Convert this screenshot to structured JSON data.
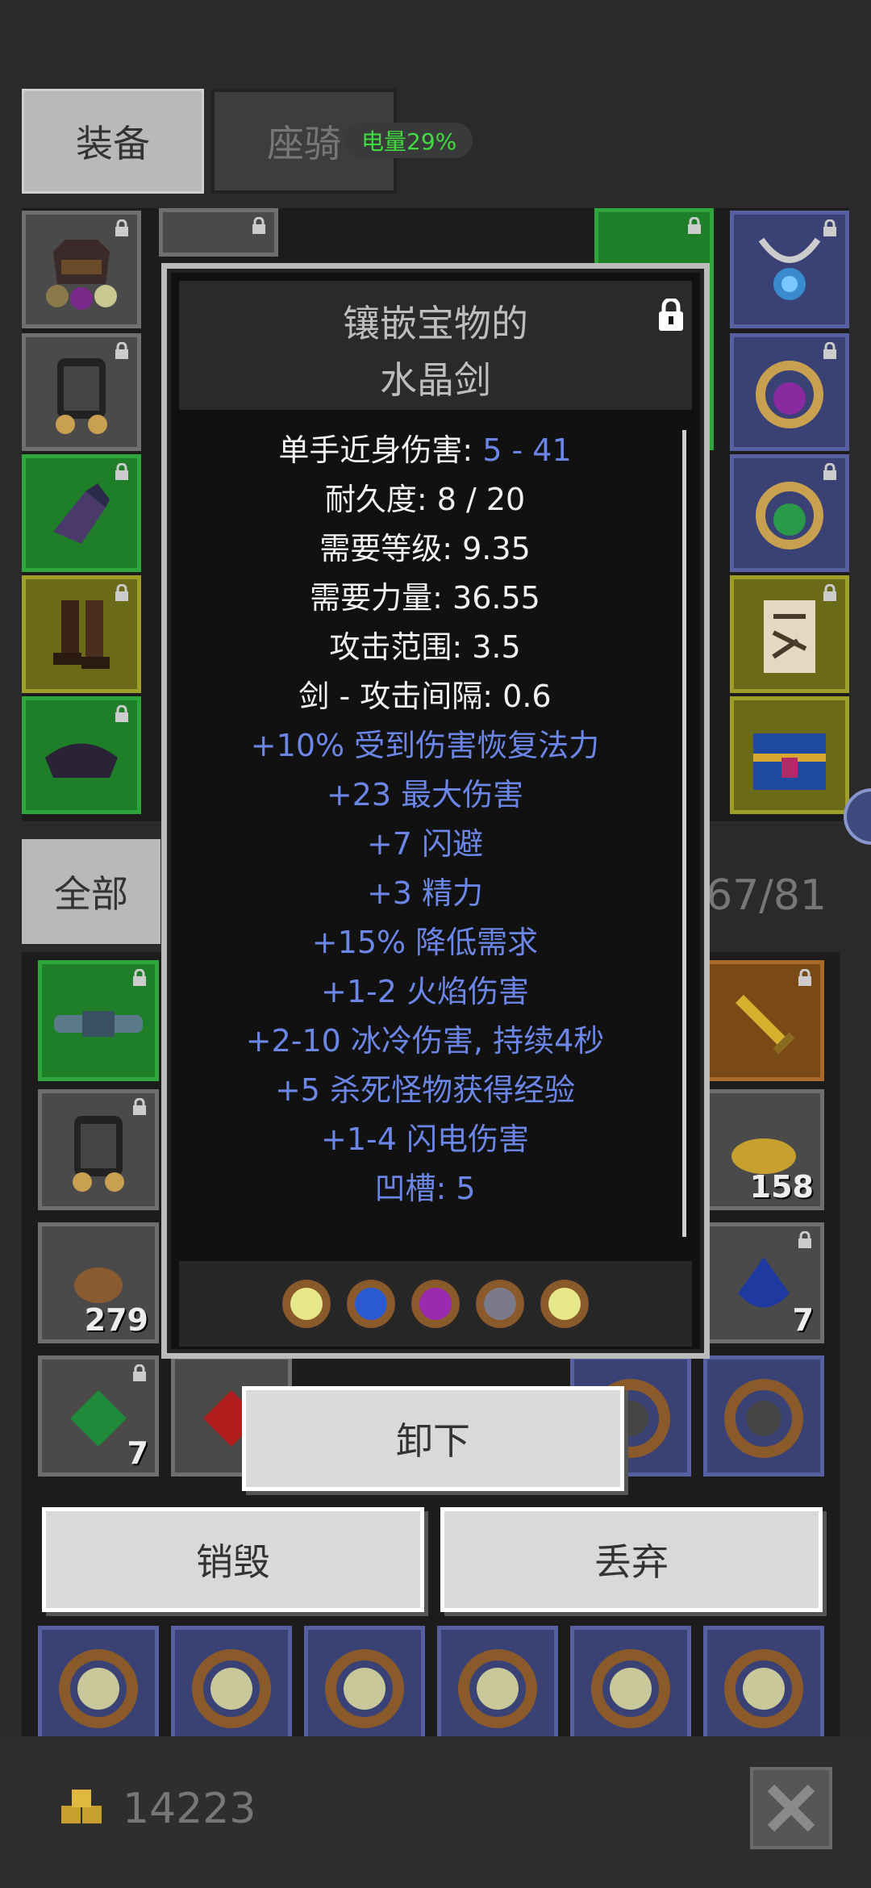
{
  "tabs": {
    "equipment": "装备",
    "mount": "座骑"
  },
  "battery": "电量29%",
  "filter": {
    "all": "全部",
    "capacity": "67/81"
  },
  "tooltip": {
    "name_line1": "镶嵌宝物的",
    "name_line2": "水晶剑",
    "stats": [
      {
        "label": "单手近身伤害: ",
        "value": "5 - 41"
      },
      {
        "label": "耐久度: 8 / 20"
      },
      {
        "label": "需要等级: 9.35"
      },
      {
        "label": "需要力量: 36.55"
      },
      {
        "label": "攻击范围: 3.5"
      },
      {
        "label": "剑 - 攻击间隔: 0.6"
      }
    ],
    "mods": [
      "+10% 受到伤害恢复法力",
      "+23 最大伤害",
      "+7 闪避",
      "+3 精力",
      "+15% 降低需求",
      "+1-2 火焰伤害",
      "+2-10 冰冷伤害, 持续4秒",
      "+5 杀死怪物获得经验",
      "+1-4 闪电伤害",
      "凹槽: 5"
    ],
    "sockets": [
      "yellow-gem",
      "blue-gem",
      "purple-gem",
      "gray-gem",
      "yellow-gem"
    ]
  },
  "buttons": {
    "unequip": "卸下",
    "destroy": "销毁",
    "discard": "丢弃"
  },
  "inventory_counts": {
    "ore": "279",
    "emerald": "7",
    "gold_pile": "158",
    "sapphire": "7"
  },
  "gold": "14223",
  "colors": {
    "mod_text": "#6b86e6",
    "battery": "#3fdc3f"
  }
}
